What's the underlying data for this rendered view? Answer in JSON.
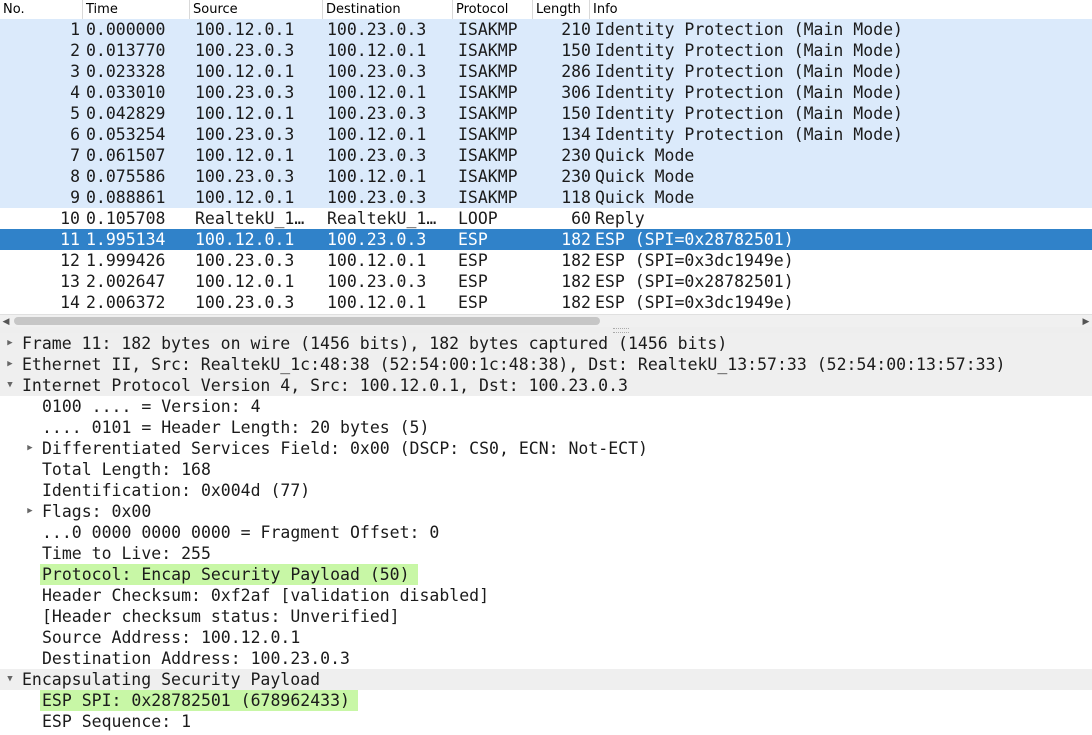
{
  "columns": {
    "no": "No.",
    "time": "Time",
    "source": "Source",
    "destination": "Destination",
    "protocol": "Protocol",
    "length": "Length",
    "info": "Info"
  },
  "packets": [
    {
      "no": "1",
      "time": "0.000000",
      "source": "100.12.0.1",
      "destination": "100.23.0.3",
      "protocol": "ISAKMP",
      "length": "210",
      "info": "Identity Protection (Main Mode)"
    },
    {
      "no": "2",
      "time": "0.013770",
      "source": "100.23.0.3",
      "destination": "100.12.0.1",
      "protocol": "ISAKMP",
      "length": "150",
      "info": "Identity Protection (Main Mode)"
    },
    {
      "no": "3",
      "time": "0.023328",
      "source": "100.12.0.1",
      "destination": "100.23.0.3",
      "protocol": "ISAKMP",
      "length": "286",
      "info": "Identity Protection (Main Mode)"
    },
    {
      "no": "4",
      "time": "0.033010",
      "source": "100.23.0.3",
      "destination": "100.12.0.1",
      "protocol": "ISAKMP",
      "length": "306",
      "info": "Identity Protection (Main Mode)"
    },
    {
      "no": "5",
      "time": "0.042829",
      "source": "100.12.0.1",
      "destination": "100.23.0.3",
      "protocol": "ISAKMP",
      "length": "150",
      "info": "Identity Protection (Main Mode)"
    },
    {
      "no": "6",
      "time": "0.053254",
      "source": "100.23.0.3",
      "destination": "100.12.0.1",
      "protocol": "ISAKMP",
      "length": "134",
      "info": "Identity Protection (Main Mode)"
    },
    {
      "no": "7",
      "time": "0.061507",
      "source": "100.12.0.1",
      "destination": "100.23.0.3",
      "protocol": "ISAKMP",
      "length": "230",
      "info": "Quick Mode"
    },
    {
      "no": "8",
      "time": "0.075586",
      "source": "100.23.0.3",
      "destination": "100.12.0.1",
      "protocol": "ISAKMP",
      "length": "230",
      "info": "Quick Mode"
    },
    {
      "no": "9",
      "time": "0.088861",
      "source": "100.12.0.1",
      "destination": "100.23.0.3",
      "protocol": "ISAKMP",
      "length": "118",
      "info": "Quick Mode"
    },
    {
      "no": "10",
      "time": "0.105708",
      "source": "RealtekU_1…",
      "destination": "RealtekU_1…",
      "protocol": "LOOP",
      "length": "60",
      "info": "Reply"
    },
    {
      "no": "11",
      "time": "1.995134",
      "source": "100.12.0.1",
      "destination": "100.23.0.3",
      "protocol": "ESP",
      "length": "182",
      "info": "ESP (SPI=0x28782501)"
    },
    {
      "no": "12",
      "time": "1.999426",
      "source": "100.23.0.3",
      "destination": "100.12.0.1",
      "protocol": "ESP",
      "length": "182",
      "info": "ESP (SPI=0x3dc1949e)"
    },
    {
      "no": "13",
      "time": "2.002647",
      "source": "100.12.0.1",
      "destination": "100.23.0.3",
      "protocol": "ESP",
      "length": "182",
      "info": "ESP (SPI=0x28782501)"
    },
    {
      "no": "14",
      "time": "2.006372",
      "source": "100.23.0.3",
      "destination": "100.12.0.1",
      "protocol": "ESP",
      "length": "182",
      "info": "ESP (SPI=0x3dc1949e)"
    }
  ],
  "details": {
    "frame": "Frame 11: 182 bytes on wire (1456 bits), 182 bytes captured (1456 bits)",
    "ethernet": "Ethernet II, Src: RealtekU_1c:48:38 (52:54:00:1c:48:38), Dst: RealtekU_13:57:33 (52:54:00:13:57:33)",
    "ip": "Internet Protocol Version 4, Src: 100.12.0.1, Dst: 100.23.0.3",
    "ip_version": "0100 .... = Version: 4",
    "ip_header_length": ".... 0101 = Header Length: 20 bytes (5)",
    "ip_dsfield": "Differentiated Services Field: 0x00 (DSCP: CS0, ECN: Not-ECT)",
    "ip_total_length": "Total Length: 168",
    "ip_identification": "Identification: 0x004d (77)",
    "ip_flags": "Flags: 0x00",
    "ip_frag_offset": "...0 0000 0000 0000 = Fragment Offset: 0",
    "ip_ttl": "Time to Live: 255",
    "ip_protocol": "Protocol: Encap Security Payload (50)",
    "ip_checksum": "Header Checksum: 0xf2af [validation disabled]",
    "ip_checksum_status": "[Header checksum status: Unverified]",
    "ip_src": "Source Address: 100.12.0.1",
    "ip_dst": "Destination Address: 100.23.0.3",
    "esp": "Encapsulating Security Payload",
    "esp_spi": "ESP SPI: 0x28782501 (678962433)",
    "esp_sequence": "ESP Sequence: 1"
  },
  "colors": {
    "row_blue": "#dbeafb",
    "row_selected": "#3082c9",
    "highlight_green": "#c8f7a6"
  }
}
